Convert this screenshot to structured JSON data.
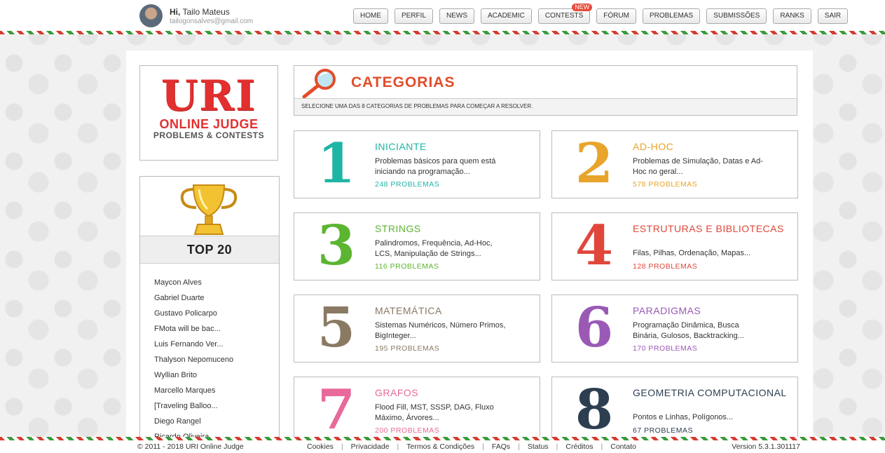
{
  "user": {
    "greeting_prefix": "Hi,",
    "name": "Tailo Mateus",
    "email": "tailogonsalves@gmail.com"
  },
  "nav": {
    "items": [
      "HOME",
      "PERFIL",
      "NEWS",
      "ACADEMIC",
      "CONTESTS",
      "FÓRUM",
      "PROBLEMAS",
      "SUBMISSÕES",
      "RANKS",
      "SAIR"
    ],
    "new_badge": "NEW"
  },
  "logo": {
    "main": "URI",
    "line1": "ONLINE JUDGE",
    "line2": "PROBLEMS & CONTESTS"
  },
  "top20": {
    "title": "TOP 20",
    "users": [
      "Maycon Alves",
      "Gabriel Duarte",
      "Gustavo Policarpo",
      "FMota will be bac...",
      "Luis Fernando Ver...",
      "Thalyson Nepomuceno",
      "Wyllian Brito",
      "Marcello Marques",
      "[Traveling Balloo...",
      "Diego Rangel",
      "Ricardo Oliveira"
    ]
  },
  "categories_header": {
    "title": "CATEGORIAS",
    "subtitle": "SELECIONE UMA DAS 8 CATEGORIAS DE PROBLEMAS PARA COMEÇAR A RESOLVER."
  },
  "categories": [
    {
      "number": "1",
      "name": "INICIANTE",
      "description": "Problemas básicos para quem está iniciando na programação...",
      "count": "248 PROBLEMAS",
      "color": "#1fb5a5"
    },
    {
      "number": "2",
      "name": "AD-HOC",
      "description": "Problemas de Simulação, Datas e Ad-Hoc no geral...",
      "count": "578 PROBLEMAS",
      "color": "#e8a42b"
    },
    {
      "number": "3",
      "name": "STRINGS",
      "description": "Palindromos, Frequência, Ad-Hoc, LCS, Manipulação de Strings...",
      "count": "116 PROBLEMAS",
      "color": "#5cb531"
    },
    {
      "number": "4",
      "name": "ESTRUTURAS E BIBLIOTECAS",
      "description": "Filas, Pilhas, Ordenação, Mapas...",
      "count": "128 PROBLEMAS",
      "color": "#e0473a"
    },
    {
      "number": "5",
      "name": "MATEMÁTICA",
      "description": "Sistemas Numéricos, Número Primos, BigInteger...",
      "count": "195 PROBLEMAS",
      "color": "#8a7a63"
    },
    {
      "number": "6",
      "name": "PARADIGMAS",
      "description": "Programação Dinâmica, Busca Binária, Gulosos, Backtracking...",
      "count": "170 PROBLEMAS",
      "color": "#9b59b6"
    },
    {
      "number": "7",
      "name": "GRAFOS",
      "description": "Flood Fill, MST, SSSP, DAG, Fluxo Máximo, Árvores...",
      "count": "200 PROBLEMAS",
      "color": "#e8699a"
    },
    {
      "number": "8",
      "name": "GEOMETRIA COMPUTACIONAL",
      "description": "Pontos e Linhas, Polígonos...",
      "count": "67 PROBLEMAS",
      "color": "#2c3e50"
    }
  ],
  "footer": {
    "copyright": "© 2011 - 2018 URI Online Judge",
    "links": [
      "Cookies",
      "Privacidade",
      "Termos & Condições",
      "FAQs",
      "Status",
      "Créditos",
      "Contato"
    ],
    "version": "Version 5.3.1.301117"
  }
}
